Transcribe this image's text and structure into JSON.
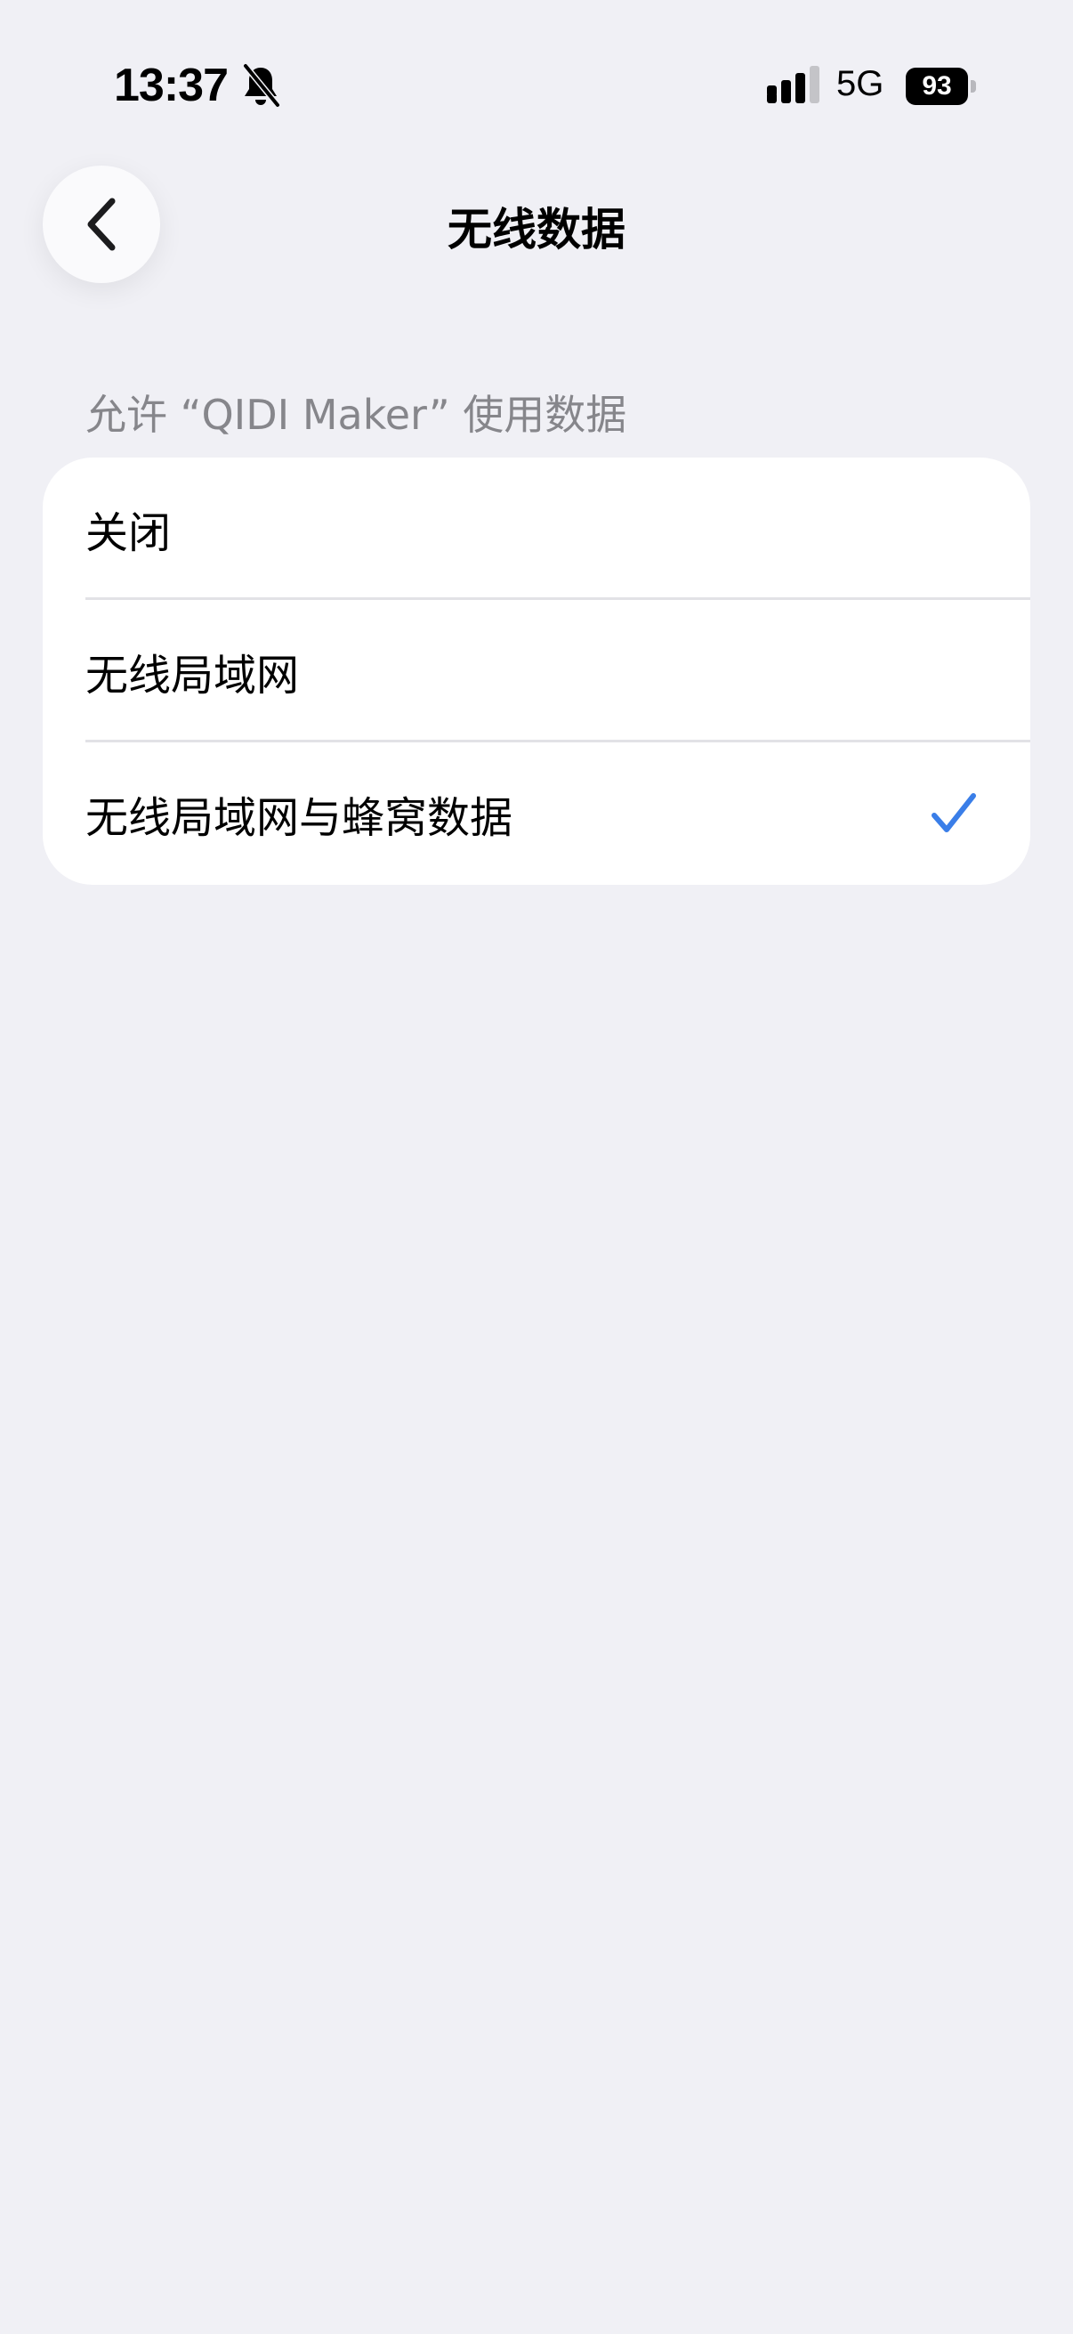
{
  "status_bar": {
    "time": "13:37",
    "network": "5G",
    "battery": "93",
    "icons": [
      "bell-slash-icon",
      "signal-icon",
      "battery-icon"
    ]
  },
  "nav": {
    "title": "无线数据",
    "back_icon": "chevron-left-icon"
  },
  "section": {
    "header": "允许 “QIDI Maker” 使用数据",
    "options": [
      {
        "label": "关闭",
        "selected": false
      },
      {
        "label": "无线局域网",
        "selected": false
      },
      {
        "label": "无线局域网与蜂窝数据",
        "selected": true
      }
    ]
  },
  "colors": {
    "background": "#f0f0f5",
    "card": "#ffffff",
    "accent": "#3a7ee8",
    "secondary_text": "#86868b"
  }
}
